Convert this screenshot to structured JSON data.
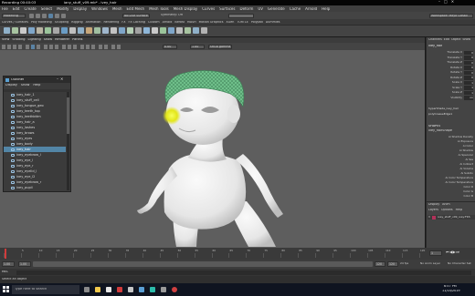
{
  "window": {
    "recording": "Recording 00:40:03",
    "title": "iany_stuff_v09.mb* - ivey_hair",
    "app": "Autodesk Maya 2018"
  },
  "menus": [
    "File",
    "Edit",
    "Create",
    "Select",
    "Modify",
    "Display",
    "Windows",
    "Mesh",
    "Edit Mesh",
    "Mesh Tools",
    "Mesh Display",
    "Curves",
    "Surfaces",
    "Deform",
    "UV",
    "Generate",
    "Cache",
    "Arnold",
    "Help"
  ],
  "status": {
    "mode": "Modeling",
    "no_live": "No Live Surface",
    "symmetry": "Symmetry: Off",
    "workspace": "Workspace: Maya Classic"
  },
  "shelf_tabs": [
    "Curves / Surfaces",
    "Poly Modeling",
    "Sculpting",
    "Rigging",
    "Animation",
    "Rendering",
    "FX",
    "FX Caching",
    "Custom",
    "Arnold",
    "Bifrost",
    "MASH",
    "Motion Graphics",
    "XGen",
    "TURTLE",
    "Polypad",
    "Dummies"
  ],
  "panel_menu": [
    "View",
    "Shading",
    "Lighting",
    "Show",
    "Renderer",
    "Panels"
  ],
  "panel_values": {
    "a": "0.00",
    "b": "1.00",
    "colorspace": "sRGB gamma"
  },
  "outliner": {
    "title": "Outliner",
    "menu": [
      "Display",
      "Show",
      "Help"
    ],
    "items": [
      "ivey_hair_1",
      "ivey_stuff_cell",
      "ivey_tongue_geo",
      "ivey_teeth_top",
      "ivey_teethbttm",
      "ivey_hair_a",
      "ivey_lashes",
      "ivey_brows",
      "ivey_eyes",
      "ivey_body",
      "ivey_hair",
      "ivey_eyebrow_l",
      "ivey_eye_l",
      "ivey_eye_r",
      "ivey_eyelid_l",
      "ivey_eye_l2",
      "ivey_eyebrow_r",
      "ivey_pupil"
    ],
    "selected_index": 10
  },
  "channel_box": {
    "tabs": [
      "Channels",
      "Edit",
      "Object",
      "Show"
    ],
    "object": "ivey_hair",
    "attributes": [
      "Translate X",
      "Translate Y",
      "Translate Z",
      "Rotate X",
      "Rotate Y",
      "Rotate Z",
      "Scale X",
      "Scale Y",
      "Scale Z",
      "Visibility"
    ],
    "values": [
      "0",
      "0",
      "0",
      "0",
      "0",
      "0",
      "1",
      "1",
      "1",
      "on"
    ],
    "inputs": [
      "hyperShade_ivey_hair",
      "polyCreaseEdge1"
    ],
    "shapes_header": "SHAPES",
    "shape": "ivey_hairShape",
    "shape_attrs": [
      "Ai Shadow Density",
      "Ai Exposure",
      "Ai Color",
      "Ai Shadow",
      "Ai Specular",
      "Ai Sss",
      "Ai Indirect",
      "Ai Volume",
      "Ai Subdiv",
      "Ai Color Temperature",
      "Ai Color Temperature",
      "Color R",
      "Color G",
      "Color B"
    ],
    "layer_tabs": [
      "Display",
      "Anim"
    ],
    "layer_menu": [
      "Layers",
      "Options",
      "Help"
    ],
    "layer_name": "ivey_stuff_v09_ivey:FKS"
  },
  "timeline": {
    "ticks": [
      "1",
      "5",
      "10",
      "15",
      "20",
      "25",
      "30",
      "35",
      "40",
      "45",
      "50",
      "55",
      "60",
      "65",
      "70",
      "75",
      "80",
      "85",
      "90",
      "95",
      "100",
      "105",
      "110",
      "115",
      "120"
    ],
    "current_frame": "1"
  },
  "range": {
    "start": "1.00",
    "inner_start": "1.00",
    "inner_end": "120",
    "end": "120",
    "end2": "200.00",
    "fps": "24 fps",
    "anim_layer": "No Anim Layer",
    "char_set": "No Character Set"
  },
  "cmd": {
    "mode": "MEL",
    "help": "Select an object"
  },
  "taskbar": {
    "search": "Type here to search",
    "time": "6:57 PM",
    "date": "11/14/2019"
  },
  "colors": {
    "accent": "#5285a6",
    "hair": "#6fbf8a",
    "highlight": "#e3e61a",
    "viewport": "#5e5e5e"
  }
}
